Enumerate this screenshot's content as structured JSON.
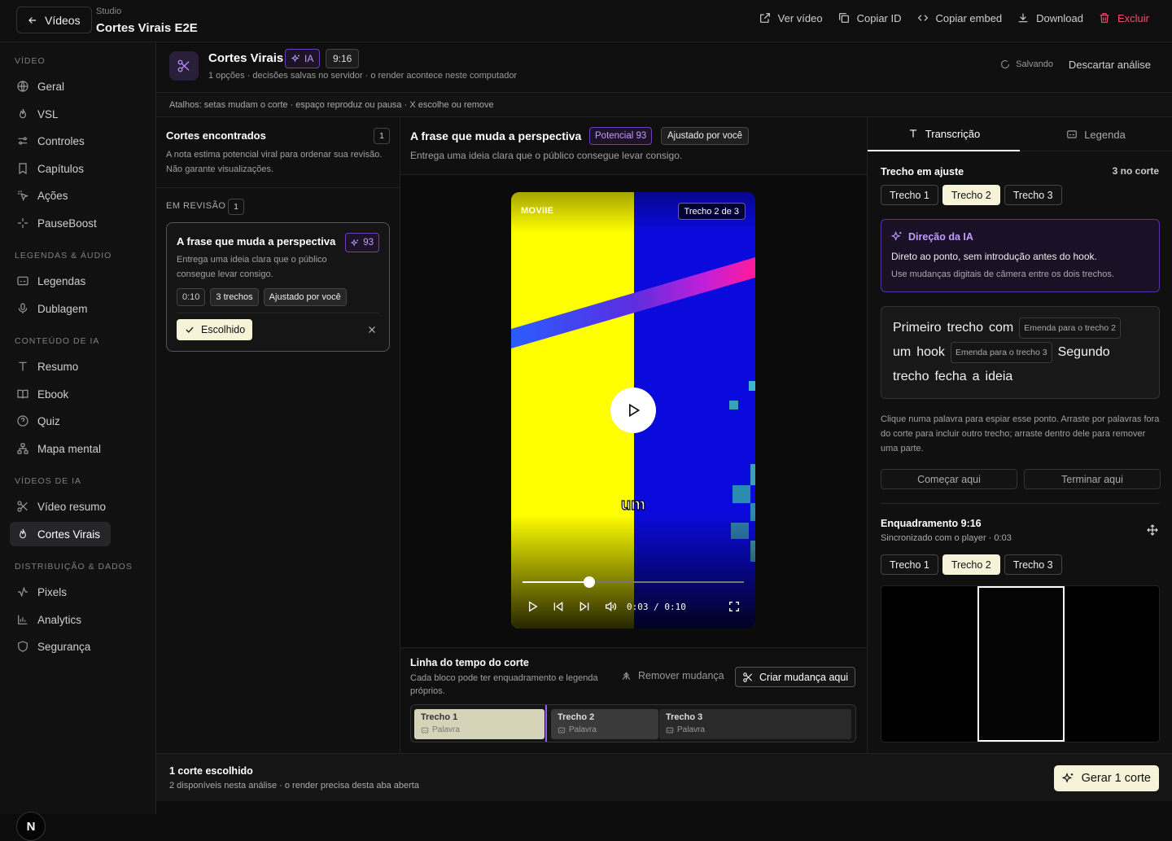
{
  "topbar": {
    "back_label": "Vídeos",
    "crumb_small": "Studio",
    "crumb_title": "Cortes Virais E2E",
    "actions": [
      {
        "label": "Ver vídeo",
        "icon": "external-link-icon"
      },
      {
        "label": "Copiar ID",
        "icon": "copy-icon"
      },
      {
        "label": "Copiar embed",
        "icon": "code-icon"
      },
      {
        "label": "Download",
        "icon": "download-icon"
      },
      {
        "label": "Excluir",
        "icon": "trash-icon"
      }
    ]
  },
  "sidebar": {
    "sections": [
      {
        "title": "VÍDEO",
        "items": [
          "Geral",
          "VSL",
          "Controles",
          "Capítulos",
          "Ações",
          "PauseBoost"
        ]
      },
      {
        "title": "LEGENDAS & ÁUDIO",
        "items": [
          "Legendas",
          "Dublagem"
        ]
      },
      {
        "title": "CONTEÚDO DE IA",
        "items": [
          "Resumo",
          "Ebook",
          "Quiz",
          "Mapa mental"
        ]
      },
      {
        "title": "VÍDEOS DE IA",
        "items": [
          "Vídeo resumo",
          "Cortes Virais"
        ]
      },
      {
        "title": "DISTRIBUIÇÃO & DADOS",
        "items": [
          "Pixels",
          "Analytics",
          "Segurança"
        ]
      }
    ],
    "active_item": "Cortes Virais",
    "avatar_letter": "N"
  },
  "header": {
    "title": "Cortes Virais",
    "badge_ia": "IA",
    "badge_ratio": "9:16",
    "subtitle": "1 opções · decisões salvas no servidor · o render acontece neste computador",
    "saving": "Salvando",
    "discard": "Descartar análise"
  },
  "shortcuts": "Atalhos: setas mudam o corte · espaço reproduz ou pausa · X escolhe ou remove",
  "cuts_panel": {
    "title": "Cortes encontrados",
    "count": "1",
    "description": "A nota estima potencial viral para ordenar sua revisão. Não garante visualizações.",
    "review_label": "EM REVISÃO",
    "review_count": "1",
    "card": {
      "title": "A frase que muda a perspectiva",
      "score": "93",
      "description": "Entrega uma ideia clara que o público consegue levar consigo.",
      "chips": [
        "0:10",
        "3 trechos",
        "Ajustado por você"
      ],
      "chosen_label": "Escolhido"
    }
  },
  "center": {
    "title": "A frase que muda a perspectiva",
    "potential": "Potencial 93",
    "adjusted": "Ajustado por você",
    "subtitle": "Entrega uma ideia clara que o público consegue levar consigo.",
    "player": {
      "logo": "MOVIIE",
      "segment_label": "Trecho 2 de 3",
      "caption": "um",
      "time": "0:03 / 0:10",
      "progress": 0.3
    },
    "timeline": {
      "title": "Linha do tempo do corte",
      "description": "Cada bloco pode ter enquadramento e legenda próprios.",
      "remove_label": "Remover mudança",
      "create_label": "Criar mudança aqui",
      "segments": [
        {
          "name": "Trecho 1",
          "sub": "Palavra"
        },
        {
          "name": "Trecho 2",
          "sub": "Palavra"
        },
        {
          "name": "Trecho 3",
          "sub": "Palavra"
        }
      ]
    }
  },
  "right": {
    "tabs": [
      "Transcrição",
      "Legenda"
    ],
    "active_tab": "Transcrição",
    "adjust_title": "Trecho em ajuste",
    "adjust_count": "3 no corte",
    "segments": [
      "Trecho 1",
      "Trecho 2",
      "Trecho 3"
    ],
    "active_segment": "Trecho 2",
    "ai": {
      "title": "Direção da IA",
      "text": "Direto ao ponto, sem introdução antes do hook.",
      "note": "Use mudanças digitais de câmera entre os dois trechos."
    },
    "words": {
      "w1": "Primeiro",
      "w2": "trecho",
      "w3": "com",
      "chip1": "Emenda para o trecho 2",
      "w4": "um",
      "w5": "hook",
      "chip2": "Emenda para o trecho 3",
      "w6": "Segundo",
      "w7": "trecho",
      "w8": "fecha",
      "w9": "a",
      "w10": "ideia"
    },
    "help": "Clique numa palavra para espiar esse ponto. Arraste por palavras fora do corte para incluir outro trecho; arraste dentro dele para remover uma parte.",
    "start_label": "Começar aqui",
    "end_label": "Terminar aqui",
    "framing_title": "Enquadramento 9:16",
    "framing_sub": "Sincronizado com o player · 0:03"
  },
  "bottom": {
    "title": "1 corte escolhido",
    "subtitle": "2 disponíveis nesta análise · o render precisa desta aba aberta",
    "generate_label": "Gerar 1 corte"
  }
}
